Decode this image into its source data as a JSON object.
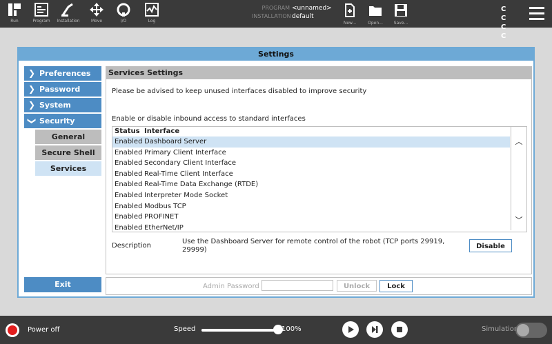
{
  "topbar": {
    "nav": [
      {
        "label": "Run",
        "icon": "ur-logo-icon"
      },
      {
        "label": "Program",
        "icon": "program-icon"
      },
      {
        "label": "Installation",
        "icon": "installation-icon"
      },
      {
        "label": "Move",
        "icon": "move-icon"
      },
      {
        "label": "I/O",
        "icon": "io-icon"
      },
      {
        "label": "Log",
        "icon": "log-icon"
      }
    ],
    "program_label": "PROGRAM",
    "program_value": "<unnamed>",
    "installation_label": "INSTALLATION",
    "installation_value": "default",
    "files": [
      {
        "label": "New...",
        "icon": "new-file-icon"
      },
      {
        "label": "Open...",
        "icon": "folder-icon"
      },
      {
        "label": "Save...",
        "icon": "save-icon"
      }
    ],
    "cc_text": "C C C C"
  },
  "dialog": {
    "title": "Settings",
    "sidebar": [
      {
        "label": "Preferences"
      },
      {
        "label": "Password"
      },
      {
        "label": "System"
      },
      {
        "label": "Security"
      }
    ],
    "sub_items": [
      {
        "label": "General"
      },
      {
        "label": "Secure Shell"
      },
      {
        "label": "Services"
      }
    ],
    "exit_label": "Exit"
  },
  "services": {
    "title": "Services Settings",
    "advice": "Please be advised to keep unused interfaces disabled to improve security",
    "enable_text": "Enable or disable inbound access to standard interfaces",
    "header_status": "Status",
    "header_interface": "Interface",
    "rows": [
      {
        "status": "Enabled",
        "interface": "Dashboard Server"
      },
      {
        "status": "Enabled",
        "interface": "Primary Client Interface"
      },
      {
        "status": "Enabled",
        "interface": "Secondary Client Interface"
      },
      {
        "status": "Enabled",
        "interface": "Real-Time Client Interface"
      },
      {
        "status": "Enabled",
        "interface": "Real-Time Data Exchange (RTDE)"
      },
      {
        "status": "Enabled",
        "interface": "Interpreter Mode Socket"
      },
      {
        "status": "Enabled",
        "interface": "Modbus TCP"
      },
      {
        "status": "Enabled",
        "interface": "PROFINET"
      },
      {
        "status": "Enabled",
        "interface": "EtherNet/IP"
      }
    ],
    "description_label": "Description",
    "description_text": "Use the Dashboard Server for remote control of the robot (TCP ports 29919, 29999)",
    "disable_label": "Disable"
  },
  "footer": {
    "admin_password_label": "Admin Password",
    "unlock_label": "Unlock",
    "lock_label": "Lock"
  },
  "bottombar": {
    "power_label": "Power off",
    "speed_label": "Speed",
    "speed_value": "100%",
    "speed_fraction": 1.0,
    "simulation_label": "Simulation"
  }
}
